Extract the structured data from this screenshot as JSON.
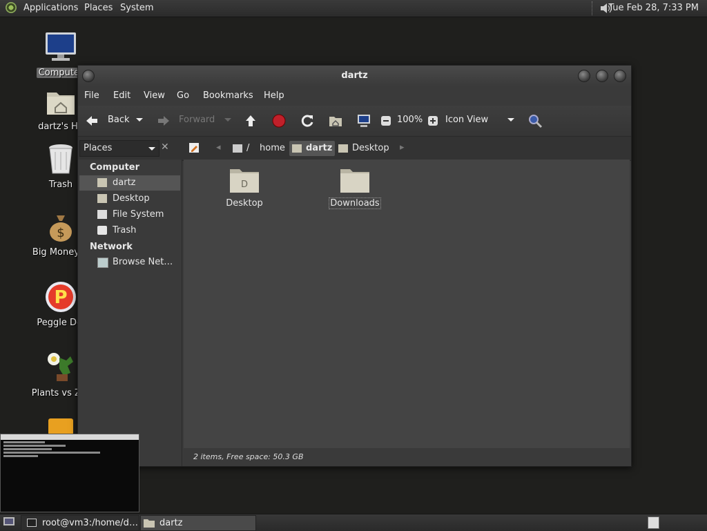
{
  "top_panel": {
    "menus": [
      "Applications",
      "Places",
      "System"
    ],
    "clock": "Tue Feb 28,  7:33 PM",
    "volume_icon": "speaker-icon"
  },
  "desktop_icons": [
    {
      "label": "Computer",
      "icon": "computer-icon"
    },
    {
      "label": "dartz's Ho",
      "icon": "home-folder-icon"
    },
    {
      "label": "Trash",
      "icon": "trash-icon"
    },
    {
      "label": "Big Money D",
      "icon": "money-bag-icon"
    },
    {
      "label": "Peggle Del",
      "icon": "peggle-icon"
    },
    {
      "label": "Plants vs Zor",
      "icon": "plants-icon"
    }
  ],
  "window": {
    "title": "dartz",
    "menubar": [
      "File",
      "Edit",
      "View",
      "Go",
      "Bookmarks",
      "Help"
    ],
    "toolbar": {
      "back": "Back",
      "forward": "Forward",
      "zoom": "100%",
      "view_mode": "Icon View"
    },
    "location": {
      "pane_selector": "Places",
      "breadcrumbs": [
        "/",
        "home",
        "dartz",
        "Desktop"
      ],
      "active_crumb": "dartz"
    },
    "sidebar": {
      "sections": [
        {
          "heading": "Computer",
          "items": [
            "dartz",
            "Desktop",
            "File System",
            "Trash"
          ]
        },
        {
          "heading": "Network",
          "items": [
            "Browse Net…"
          ]
        }
      ],
      "selected": "dartz"
    },
    "files": [
      "Desktop",
      "Downloads"
    ],
    "status": "2 items, Free space: 50.3 GB"
  },
  "taskbar": {
    "tasks": [
      "root@vm3:/home/d…",
      "dartz"
    ]
  },
  "colors": {
    "desktop_bg": "#1f1f1d",
    "window_bg": "#3b3b3b",
    "content_bg": "#444444",
    "stop_red": "#c0202a",
    "folder_beige": "#d8d4c4"
  }
}
